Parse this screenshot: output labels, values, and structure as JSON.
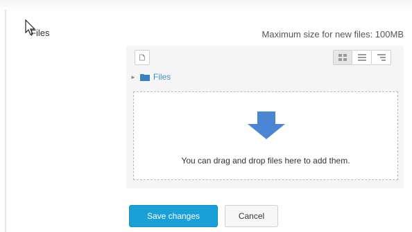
{
  "form": {
    "field_label": "Files",
    "max_size_text": "Maximum size for new files: 100MB"
  },
  "filepicker": {
    "toolbar": {
      "add_file_icon": "file-add-icon",
      "view_icons_icon": "grid-view-icon",
      "view_list_icon": "list-view-icon",
      "view_tree_icon": "tree-view-icon",
      "active_view": "icons"
    },
    "path": {
      "folder_icon": "folder-icon",
      "label": "Files"
    },
    "dropzone": {
      "arrow_icon": "down-arrow-icon",
      "text": "You can drag and drop files here to add them."
    }
  },
  "actions": {
    "save_label": "Save changes",
    "cancel_label": "Cancel"
  },
  "colors": {
    "primary": "#1aa0d8",
    "link": "#3a93c9",
    "arrow": "#4a86d4",
    "panel_bg": "#f5f5f5"
  }
}
